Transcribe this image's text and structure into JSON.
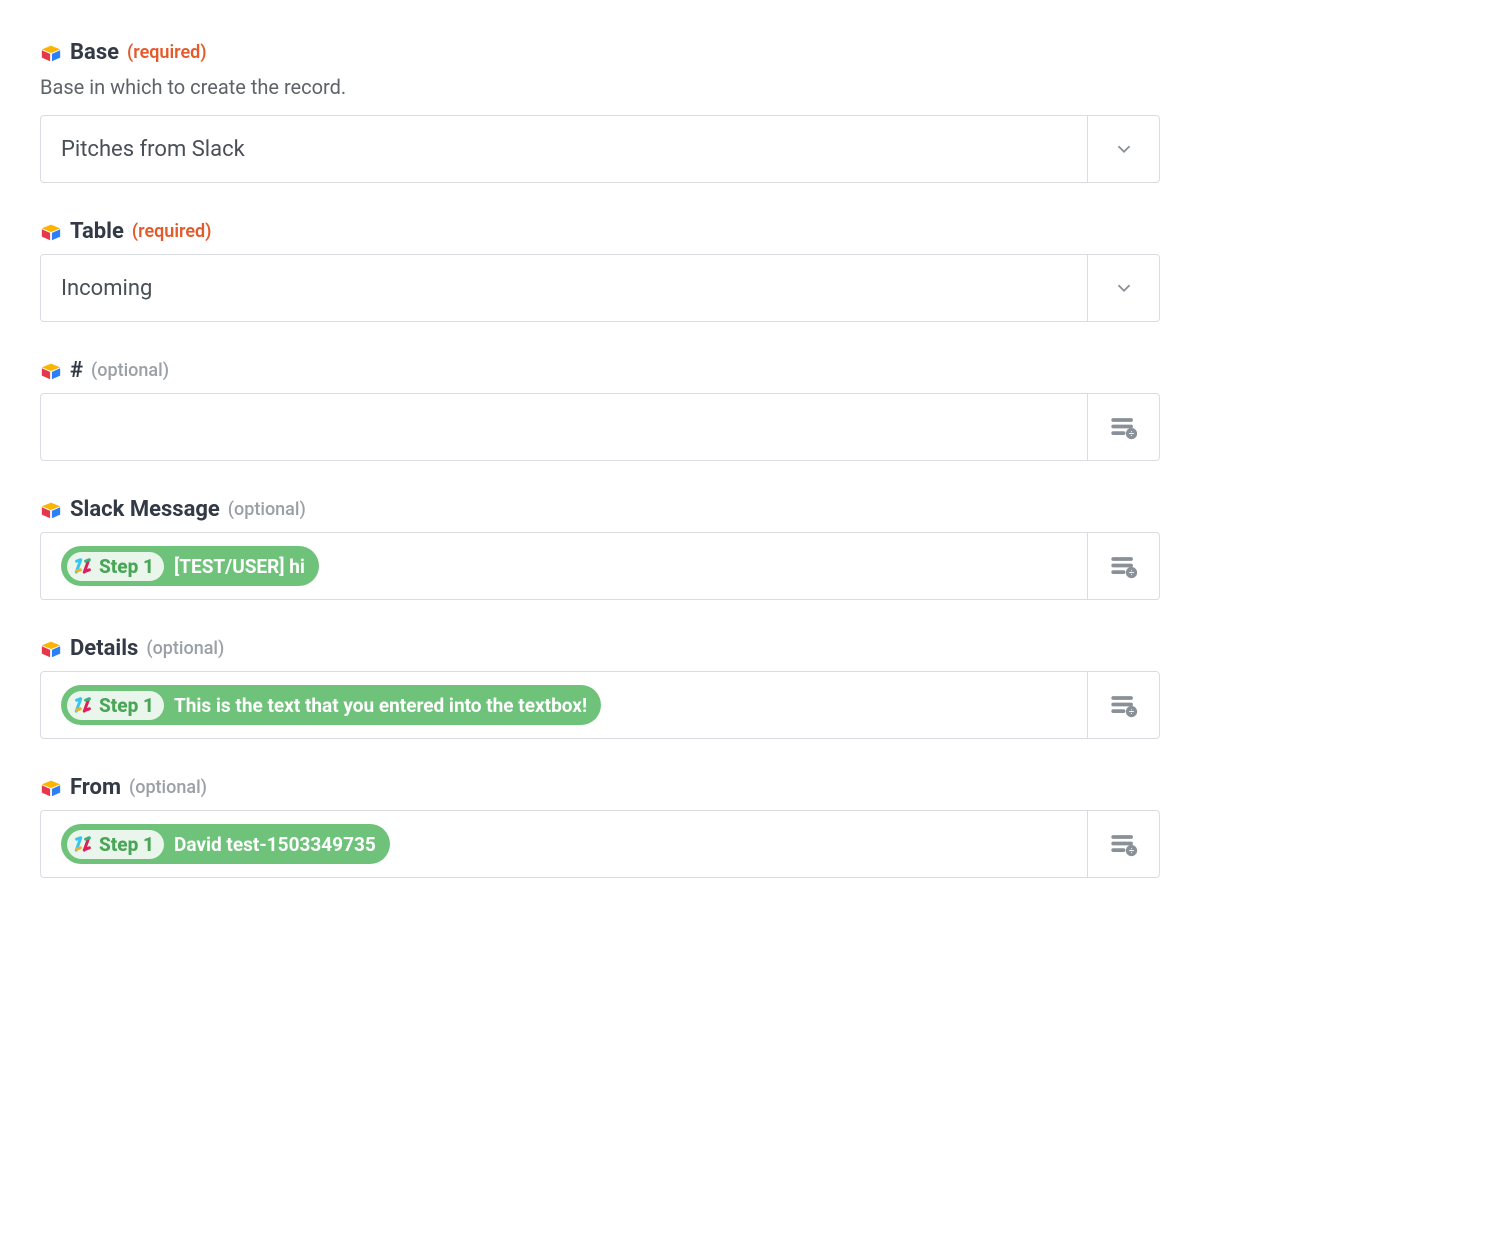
{
  "fields": {
    "base": {
      "label": "Base",
      "req_tag": "(required)",
      "help": "Base in which to create the record.",
      "value": "Pitches from Slack"
    },
    "table": {
      "label": "Table",
      "req_tag": "(required)",
      "value": "Incoming"
    },
    "number": {
      "label": "#",
      "opt_tag": "(optional)"
    },
    "slack_message": {
      "label": "Slack Message",
      "opt_tag": "(optional)",
      "pill_step": "Step 1",
      "pill_value": "[TEST/USER] hi"
    },
    "details": {
      "label": "Details",
      "opt_tag": "(optional)",
      "pill_step": "Step 1",
      "pill_value": "This is the text that you entered into the textbox!"
    },
    "from": {
      "label": "From",
      "opt_tag": "(optional)",
      "pill_step": "Step 1",
      "pill_value": "David test-1503349735"
    }
  }
}
